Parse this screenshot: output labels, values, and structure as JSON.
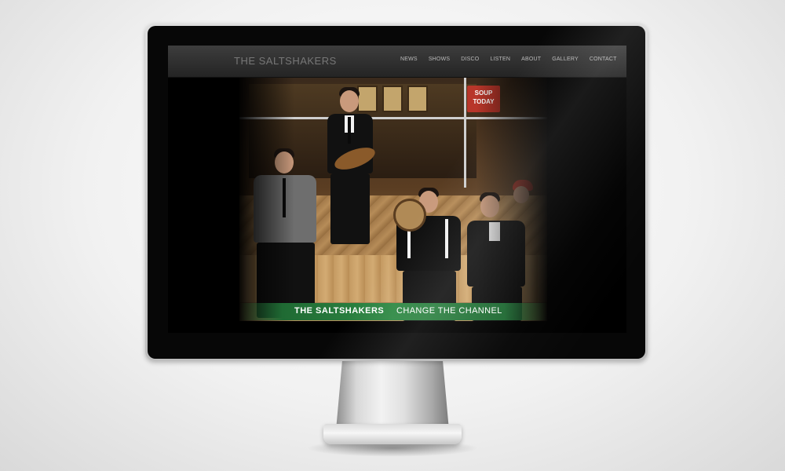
{
  "site": {
    "logo": "THE SALTSHAKERS",
    "nav": [
      "NEWS",
      "SHOWS",
      "DISCO",
      "LISTEN",
      "ABOUT",
      "GALLERY",
      "CONTACT"
    ]
  },
  "hero": {
    "sign_text": "SOUP TODAY",
    "banner_brand": "THE SALTSHAKERS",
    "banner_tagline": "CHANGE THE CHANNEL"
  },
  "colors": {
    "header_bg": "#2b2b2b",
    "banner_green": "#2f8a45",
    "sign_red": "#b8362a"
  }
}
